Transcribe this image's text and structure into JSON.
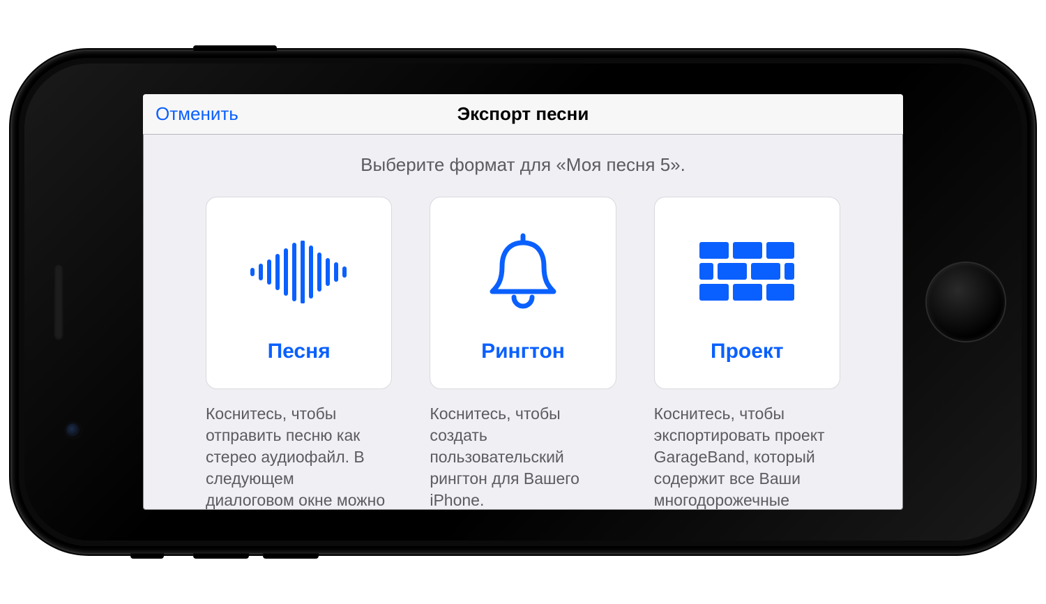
{
  "nav": {
    "cancel_label": "Отменить",
    "title": "Экспорт песни"
  },
  "subtitle": "Выберите формат для «Моя песня 5».",
  "options": {
    "song": {
      "label": "Песня",
      "desc": "Коснитесь, чтобы отправить песню как стерео аудиофайл. В следующем диалоговом окне можно задать дополнительные"
    },
    "ringtone": {
      "label": "Рингтон",
      "desc": "Коснитесь, чтобы создать пользовательский рингтон для Вашего iPhone."
    },
    "project": {
      "label": "Проект",
      "desc": "Коснитесь, чтобы экспортировать проект GarageBand, который содержит все Ваши многодорожечные записи."
    }
  },
  "colors": {
    "accent": "#0a60ff"
  }
}
